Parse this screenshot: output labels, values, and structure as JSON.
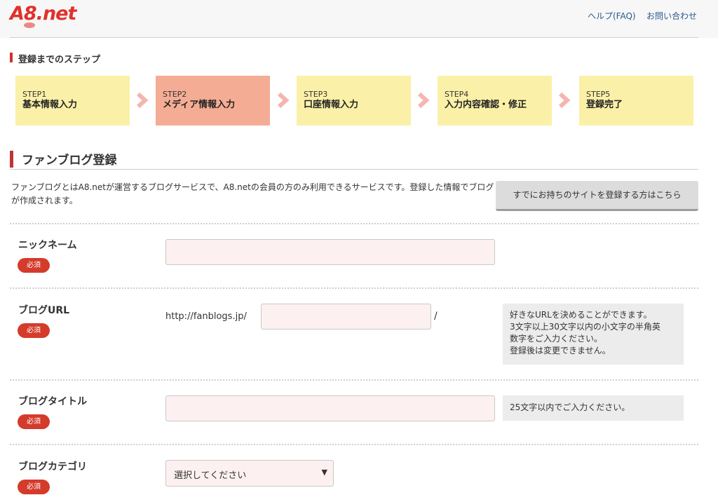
{
  "header": {
    "logo_text": "A8.net",
    "links": {
      "help": "ヘルプ(FAQ)",
      "contact": "お問い合わせ"
    }
  },
  "steps": {
    "title": "登録までのステップ",
    "items": [
      {
        "num": "STEP1",
        "name": "基本情報入力",
        "active": false
      },
      {
        "num": "STEP2",
        "name": "メディア情報入力",
        "active": true
      },
      {
        "num": "STEP3",
        "name": "口座情報入力",
        "active": false
      },
      {
        "num": "STEP4",
        "name": "入力内容確認・修正",
        "active": false
      },
      {
        "num": "STEP5",
        "name": "登録完了",
        "active": false
      }
    ]
  },
  "section": {
    "title": "ファンブログ登録",
    "description": "ファンブログとはA8.netが運営するブログサービスで、A8.netの会員の方のみ利用できるサービスです。登録した情報でブログが作成されます。",
    "existing_site_button": "すでにお持ちのサイトを登録する方はこちら"
  },
  "form": {
    "required_label": "必須",
    "nickname": {
      "label": "ニックネーム",
      "value": "",
      "placeholder": ""
    },
    "blog_url": {
      "label": "ブログURL",
      "prefix": "http://fanblogs.jp/",
      "suffix": "/",
      "value": "",
      "note_lines": [
        "好きなURLを決めることができます。",
        "3文字以上30文字以内の小文字の半角英",
        "数字をご入力ください。",
        "登録後は変更できません。"
      ]
    },
    "blog_title": {
      "label": "ブログタイトル",
      "value": "",
      "note": "25文字以内でご入力ください。"
    },
    "blog_category": {
      "label": "ブログカテゴリ",
      "selected": "選択してください"
    }
  },
  "colors": {
    "brand_red": "#e0312c",
    "step_default": "#fbf0a7",
    "step_active": "#f4ad94",
    "required_badge": "#d43b2b",
    "input_bg": "#fcf1f0",
    "note_bg": "#ececec",
    "link": "#2a5a8c"
  },
  "icons": {
    "step_chevron": "chevron-right-icon",
    "select_arrow": "triangle-down-icon"
  }
}
